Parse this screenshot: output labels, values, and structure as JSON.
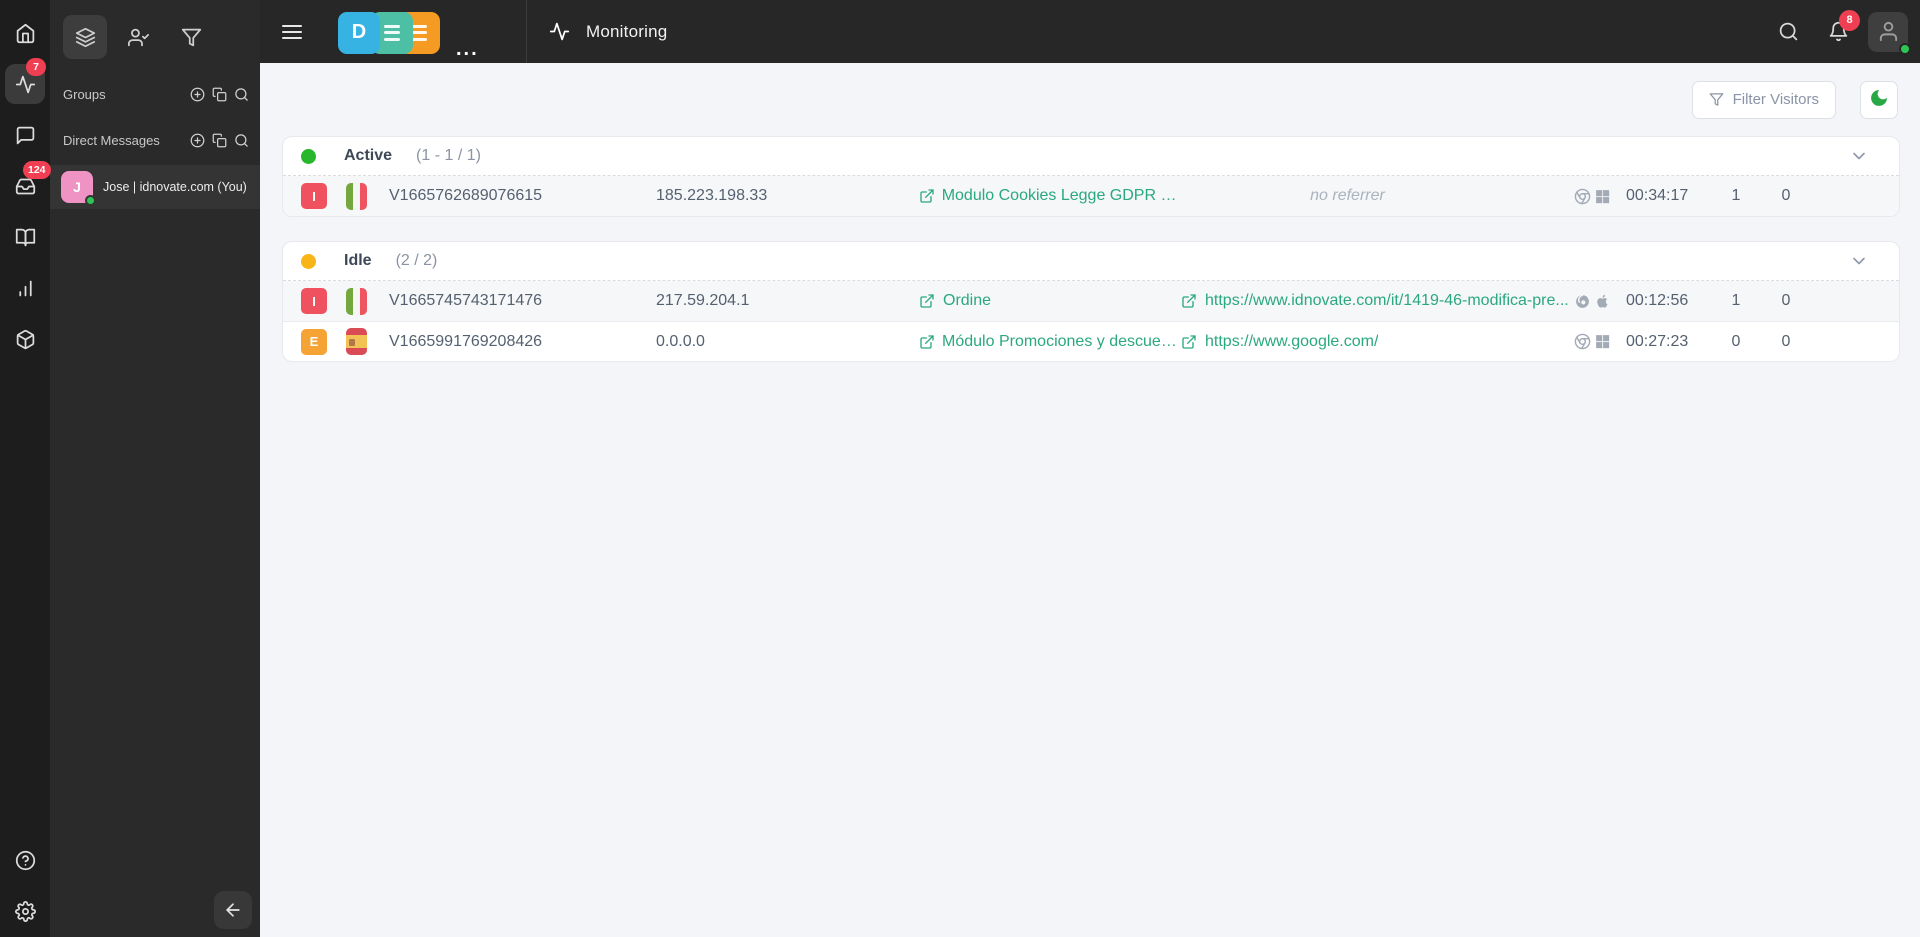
{
  "colors": {
    "accent_link_green": "#2aa87e",
    "active_dot_green": "#28b62c",
    "idle_dot_yellow": "#f7b519",
    "notification_red": "#f03e52",
    "lang_badge_red": "#f0515f",
    "lang_badge_orange": "#f6a335",
    "avatar_pink": "#ef93c5",
    "presence_green": "#2dc653",
    "logo_blue": "#36b3e3",
    "logo_teal": "#4dbfa4",
    "logo_orange": "#f59b23",
    "moon_green": "#28a745"
  },
  "icons": {
    "rail": [
      "home",
      "activity",
      "chat-bubble",
      "inbox",
      "book-open",
      "bar-chart",
      "package-box",
      "help-circle",
      "settings-gear"
    ],
    "panel_tools": [
      "layers",
      "user-check",
      "filter-funnel"
    ],
    "section_actions": [
      "plus-circle",
      "copy",
      "search"
    ],
    "topbar": [
      "hamburger-menu",
      "activity",
      "search",
      "bell",
      "user-avatar"
    ],
    "row_icons": [
      "external-link",
      "chrome",
      "firefox",
      "windows",
      "apple"
    ]
  },
  "rail": {
    "activity_badge": "7",
    "inbox_badge": "124"
  },
  "sidebar": {
    "groups_label": "Groups",
    "direct_messages_label": "Direct Messages",
    "dm_user": {
      "initial": "J",
      "name": "Jose | idnovate.com (You)"
    }
  },
  "topbar": {
    "workspace_letter": "D",
    "more_label": "...",
    "title": "Monitoring",
    "notifications_badge": "8"
  },
  "toolbar": {
    "filter_button": "Filter Visitors"
  },
  "visitors": {
    "groups": [
      {
        "name": "Active",
        "count": "(1 - 1 / 1)",
        "status_color": "#28b62c",
        "rows": [
          {
            "lang_badge": "I",
            "country": "Italy",
            "visitor_id": "V1665762689076615",
            "ip": "185.223.198.33",
            "page": "Modulo Cookies Legge GDPR (Blo...",
            "referrer": "no referrer",
            "browser": "Chrome",
            "os": "Windows",
            "time_on_site": "00:34:17",
            "chats": "1",
            "pending": "0"
          }
        ]
      },
      {
        "name": "Idle",
        "count": "(2 / 2)",
        "status_color": "#f7b519",
        "rows": [
          {
            "lang_badge": "I",
            "country": "Italy",
            "visitor_id": "V1665745743171476",
            "ip": "217.59.204.1",
            "page": "Ordine",
            "referrer": "https://www.idnovate.com/it/1419-46-modifica-pre...",
            "browser": "Firefox",
            "os": "Mac",
            "time_on_site": "00:12:56",
            "chats": "1",
            "pending": "0"
          },
          {
            "lang_badge": "E",
            "country": "Spain",
            "visitor_id": "V1665991769208426",
            "ip": "0.0.0.0",
            "page": "Módulo Promociones y descuento...",
            "referrer": "https://www.google.com/",
            "browser": "Chrome",
            "os": "Windows",
            "time_on_site": "00:27:23",
            "chats": "0",
            "pending": "0"
          }
        ]
      }
    ]
  }
}
